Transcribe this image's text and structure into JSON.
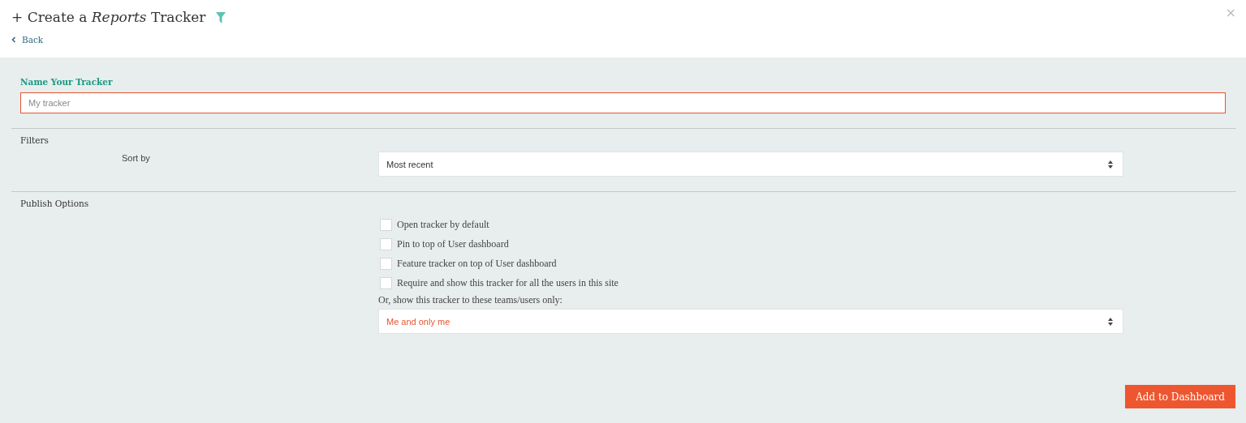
{
  "header": {
    "title": "+ Create a *Reports* Tracker",
    "close": "×",
    "back": "Back"
  },
  "name_field": {
    "label": "Name Your Tracker",
    "placeholder": "My tracker"
  },
  "filters": {
    "heading": "Filters",
    "sort_label": "Sort by",
    "sort_value": "Most recent"
  },
  "publish": {
    "heading": "Publish Options",
    "options": [
      {
        "label": "Open tracker by default",
        "checked": false
      },
      {
        "label": "Pin to top of User dashboard",
        "checked": false
      },
      {
        "label": "Feature tracker on top of User dashboard",
        "checked": false
      },
      {
        "label": "Require and show this tracker for all the users in this site",
        "checked": false
      }
    ],
    "audience_label": "Or, show this tracker to these teams/users only:",
    "audience_value": "Me and only me"
  },
  "submit": "Add to Dashboard"
}
